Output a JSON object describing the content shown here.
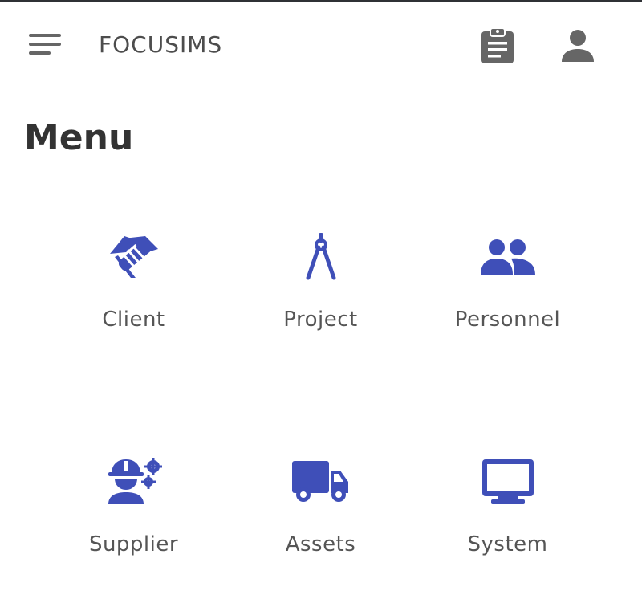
{
  "header": {
    "app_title": "FOCUSIMS",
    "menu_icon": "hamburger-menu-icon",
    "clipboard_icon": "clipboard-list-icon",
    "user_icon": "user-account-icon"
  },
  "main": {
    "title": "Menu",
    "tiles": [
      {
        "label": "Client",
        "icon": "handshake-icon"
      },
      {
        "label": "Project",
        "icon": "drafting-compass-icon"
      },
      {
        "label": "Personnel",
        "icon": "people-group-icon"
      },
      {
        "label": "Supplier",
        "icon": "worker-gears-icon"
      },
      {
        "label": "Assets",
        "icon": "truck-icon"
      },
      {
        "label": "System",
        "icon": "monitor-icon"
      }
    ]
  },
  "colors": {
    "accent": "#3f4fb8",
    "header_icons": "#666666",
    "title_text": "#333333",
    "label_text": "#555555"
  }
}
